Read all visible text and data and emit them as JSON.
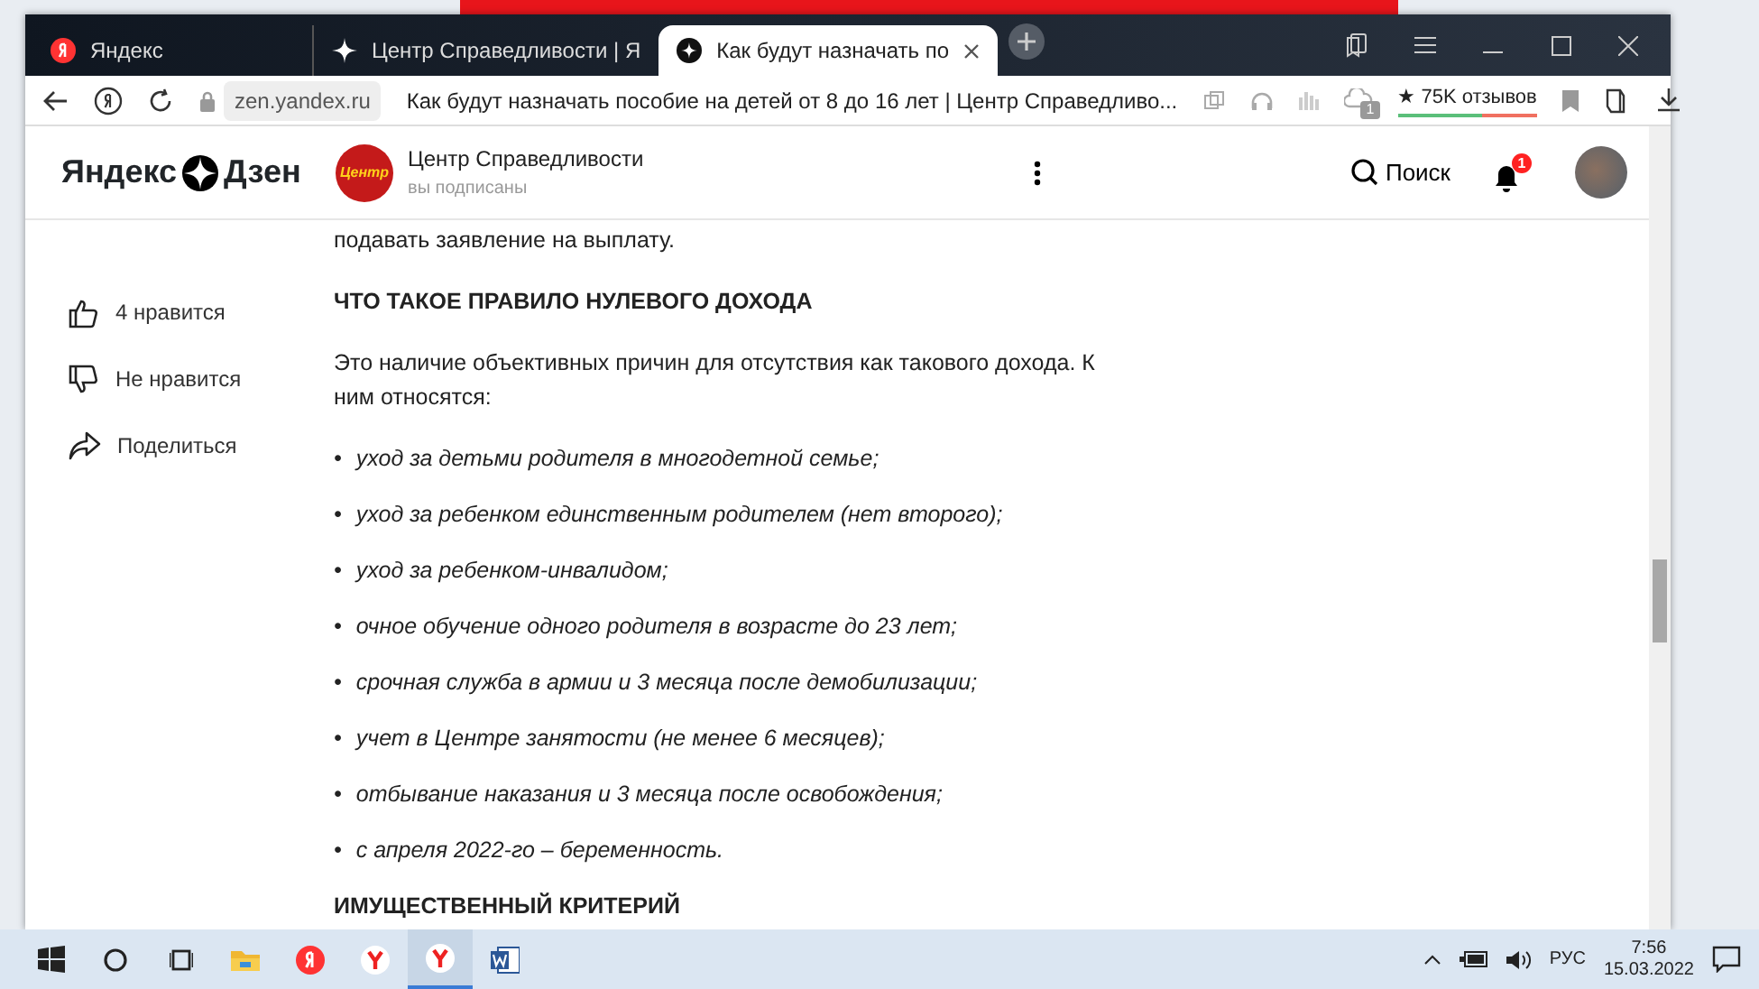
{
  "browser": {
    "tabs": [
      {
        "label": "Яндекс",
        "selected": false,
        "kind": "yandex"
      },
      {
        "label": "Центр Справедливости | Я",
        "selected": false,
        "kind": "zen"
      },
      {
        "label": "Как будут назначать по",
        "selected": true,
        "kind": "zen"
      }
    ],
    "address_bar": {
      "domain": "zen.yandex.ru",
      "page_title": "Как будут назначать пособие на детей от 8 до 16 лет | Центр Справедливо...",
      "extension_badge": "1",
      "reviews": "★ 75K отзывов"
    }
  },
  "zen_header": {
    "logo_left": "Яндекс",
    "logo_right": "Дзен",
    "channel": {
      "avatar_text": "Центр",
      "name": "Центр Справедливости",
      "subtitle": "вы подписаны"
    },
    "search": "Поиск",
    "notifications": "1"
  },
  "actions": [
    {
      "kind": "like",
      "label": "4 нравится"
    },
    {
      "kind": "dislike",
      "label": "Не нравится"
    },
    {
      "kind": "share",
      "label": "Поделиться"
    }
  ],
  "article": [
    {
      "kind": "text",
      "text": "подавать заявление на выплату."
    },
    {
      "kind": "heading",
      "text": "ЧТО ТАКОЕ ПРАВИЛО НУЛЕВОГО ДОХОДА"
    },
    {
      "kind": "text",
      "text": "Это наличие объективных причин для отсутствия как такового дохода. К ним относятся:"
    },
    {
      "kind": "list",
      "bullet": "•",
      "items": [
        "уход за детьми родителя в многодетной семье;",
        "уход за ребенком единственным родителем (нет второго);",
        "уход за ребенком-инвалидом;",
        "очное обучение одного родителя в возрасте до 23 лет;",
        "срочная служба в армии и 3 месяца после демобилизации;",
        "учет в Центре занятости (не менее 6 месяцев);",
        "отбывание наказания и 3 месяца после освобождения;",
        "с апреля 2022-го – беременность."
      ]
    },
    {
      "kind": "heading",
      "text": "ИМУЩЕСТВЕННЫЙ КРИТЕРИЙ"
    }
  ],
  "taskbar": {
    "apps": [
      {
        "kind": "explorer",
        "active": false
      },
      {
        "kind": "yandex",
        "active": false
      },
      {
        "kind": "ybrowser",
        "active": false
      },
      {
        "kind": "ybrowser",
        "active": true
      },
      {
        "kind": "word",
        "active": false
      }
    ],
    "language": "РУС",
    "time": "7:56",
    "date": "15.03.2022"
  }
}
